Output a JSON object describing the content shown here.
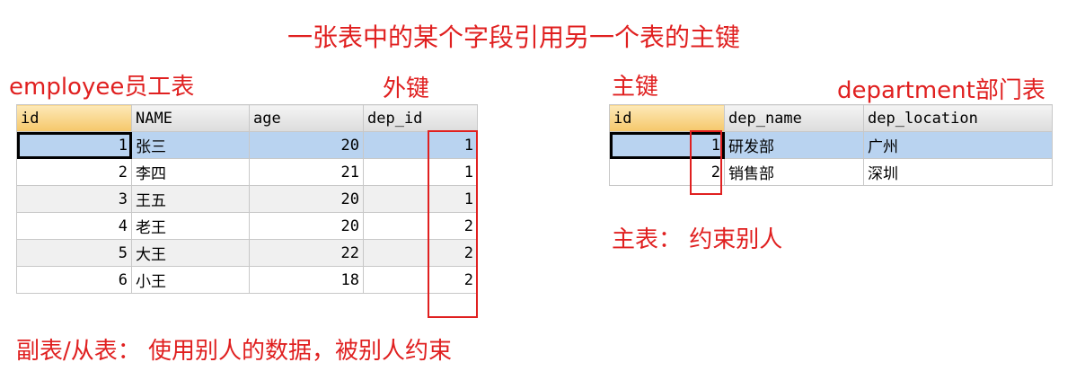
{
  "title": "一张表中的某个字段引用另一个表的主键",
  "labels": {
    "employee_table": "employee员工表",
    "foreign_key": "外键",
    "primary_key": "主键",
    "department_table": "department部门表",
    "main_table_note": "主表： 约束别人",
    "sub_table_note": "副表/从表： 使用别人的数据，被别人约束"
  },
  "employee": {
    "columns": [
      "id",
      "NAME",
      "age",
      "dep_id"
    ],
    "rows": [
      [
        "1",
        "张三",
        "20",
        "1"
      ],
      [
        "2",
        "李四",
        "21",
        "1"
      ],
      [
        "3",
        "王五",
        "20",
        "1"
      ],
      [
        "4",
        "老王",
        "20",
        "2"
      ],
      [
        "5",
        "大王",
        "22",
        "2"
      ],
      [
        "6",
        "小王",
        "18",
        "2"
      ]
    ]
  },
  "department": {
    "columns": [
      "id",
      "dep_name",
      "dep_location"
    ],
    "rows": [
      [
        "1",
        "研发部",
        "广州"
      ],
      [
        "2",
        "销售部",
        "深圳"
      ]
    ]
  },
  "colors": {
    "annotation_red": "#e02020",
    "selected_row": "#b9d3f0",
    "active_header": "#f5c76a"
  }
}
